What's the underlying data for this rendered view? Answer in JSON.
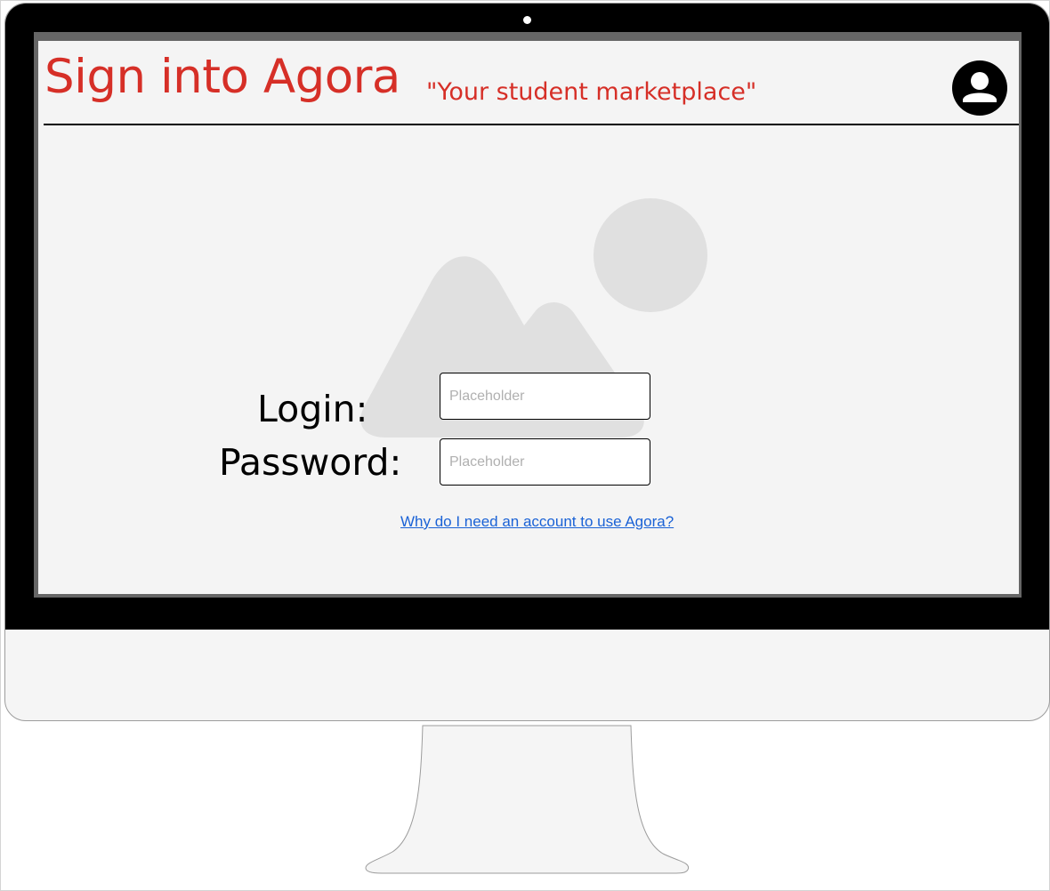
{
  "header": {
    "title": "Sign into Agora",
    "tagline": "\"Your student marketplace\""
  },
  "icons": {
    "account": "user-circle-icon",
    "hero": "image-placeholder-icon"
  },
  "form": {
    "login_label": "Login:",
    "login_placeholder": "Placeholder",
    "login_value": "",
    "password_label": "Password:",
    "password_placeholder": "Placeholder",
    "password_value": ""
  },
  "help_link": "Why do I need an account to use Agora?",
  "colors": {
    "brand_red": "#d62f27",
    "link_blue": "#1a62d6",
    "bezel": "#000000",
    "screen_bg": "#f4f4f4",
    "placeholder_shape": "#e0e0e0"
  }
}
